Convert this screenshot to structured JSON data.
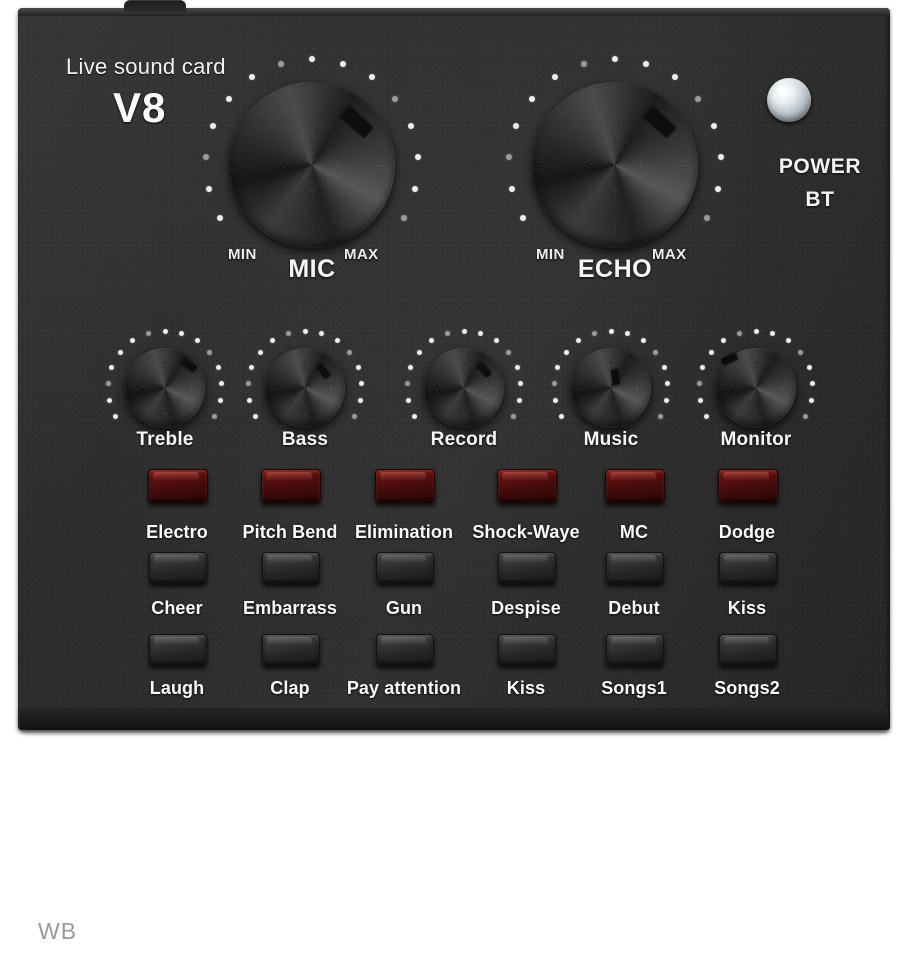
{
  "product": {
    "brand_title": "Live sound card",
    "model": "V8"
  },
  "watermark": "WB",
  "colors": {
    "body": "#2d2d2d",
    "label_text": "#fafafa",
    "red_button": "#5e1010",
    "dark_button": "#3b3b3b",
    "watermark": "#9a9a9a"
  },
  "indicators": {
    "power_led": "power-led-indicator",
    "power_label": "POWER",
    "bt_label": "BT"
  },
  "main_knobs": [
    {
      "name": "MIC",
      "min_label": "MIN",
      "max_label": "MAX",
      "pointer_angle_deg": 222
    },
    {
      "name": "ECHO",
      "min_label": "MIN",
      "max_label": "MAX",
      "pointer_angle_deg": 222
    }
  ],
  "small_knobs": [
    {
      "name": "Treble",
      "pointer_angle_deg": 216
    },
    {
      "name": "Bass",
      "pointer_angle_deg": 232
    },
    {
      "name": "Record",
      "pointer_angle_deg": 228
    },
    {
      "name": "Music",
      "pointer_angle_deg": 262
    },
    {
      "name": "Monitor",
      "pointer_angle_deg": 338
    }
  ],
  "button_rows": [
    {
      "type": "red",
      "buttons": [
        {
          "label": "Electro"
        },
        {
          "label": "Pitch Bend"
        },
        {
          "label": "Elimination"
        },
        {
          "label": "Shock-Waye"
        },
        {
          "label": "MC"
        },
        {
          "label": "Dodge"
        }
      ]
    },
    {
      "type": "dark",
      "buttons": [
        {
          "label": "Cheer"
        },
        {
          "label": "Embarrass"
        },
        {
          "label": "Gun"
        },
        {
          "label": "Despise"
        },
        {
          "label": "Debut"
        },
        {
          "label": "Kiss"
        }
      ]
    },
    {
      "type": "dark",
      "buttons": [
        {
          "label": "Laugh"
        },
        {
          "label": "Clap"
        },
        {
          "label": "Pay attention"
        },
        {
          "label": "Kiss"
        },
        {
          "label": "Songs1"
        },
        {
          "label": "Songs2"
        }
      ]
    }
  ]
}
